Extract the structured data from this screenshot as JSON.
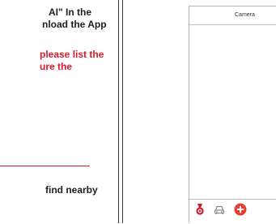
{
  "instructions": {
    "line1": "AI\"  In the",
    "line2": "nload the App",
    "red_line1": "please list the",
    "red_line2": "ure the",
    "line5": "find nearby"
  },
  "phone": {
    "header_title": "Camera",
    "tabbar": {
      "icons": [
        "medal-icon",
        "car-icon",
        "add-circle-icon"
      ]
    }
  },
  "colors": {
    "accent_red": "#d81b2c",
    "text_dark": "#1f1f1f",
    "phone_border": "#b5b5b5"
  }
}
